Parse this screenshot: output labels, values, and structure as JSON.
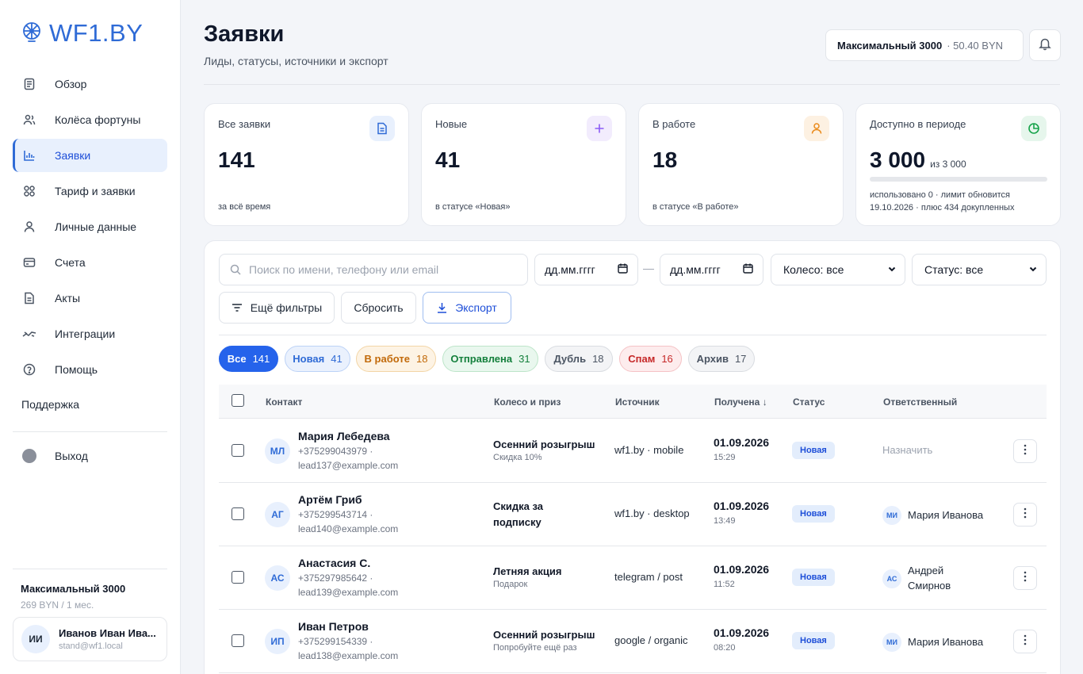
{
  "brand": {
    "logo_text": "WF1.BY",
    "accent": "#2f6bd6"
  },
  "sidebar": {
    "items": [
      {
        "label": "Обзор",
        "icon": "document-list-icon"
      },
      {
        "label": "Колёса фортуны",
        "icon": "users-icon"
      },
      {
        "label": "Заявки",
        "icon": "bar-chart-icon",
        "active": true
      },
      {
        "label": "Тариф и заявки",
        "icon": "grid-icon"
      },
      {
        "label": "Личные данные",
        "icon": "user-icon"
      },
      {
        "label": "Счета",
        "icon": "credit-card-icon"
      },
      {
        "label": "Акты",
        "icon": "file-icon"
      },
      {
        "label": "Интеграции",
        "icon": "link-icon"
      },
      {
        "label": "Помощь",
        "icon": "help-circle-icon"
      }
    ],
    "support": "Поддержка",
    "exit": "Выход",
    "plan_name": "Максимальный 3000",
    "plan_price": "269 BYN / 1 мес.",
    "user": {
      "initials": "ИИ",
      "name": "Иванов Иван Ива...",
      "email": "stand@wf1.local"
    }
  },
  "header": {
    "title": "Заявки",
    "subtitle": "Лиды, статусы, источники и экспорт",
    "plan_label": "Максимальный 3000",
    "plan_balance": "· 50.40 BYN"
  },
  "stats": [
    {
      "label": "Все заявки",
      "value": "141",
      "foot": "за всё время",
      "icon": "document-icon",
      "color": "#2f6bd6"
    },
    {
      "label": "Новые",
      "value": "41",
      "foot": "в статусе «Новая»",
      "icon": "plus-icon",
      "color": "#8b5cf6"
    },
    {
      "label": "В работе",
      "value": "18",
      "foot": "в статусе «В работе»",
      "icon": "user-icon",
      "color": "#ea8a1a"
    },
    {
      "label": "Доступно в периоде",
      "value": "3 000",
      "of": "из 3 000",
      "progress": 0.0,
      "foot_line1": "использовано 0 · лимит обновится",
      "foot_line2": "19.10.2026 · плюс 434 докупленных",
      "icon": "pie-chart-icon",
      "color": "#16a34a"
    }
  ],
  "filters": {
    "search_placeholder": "Поиск по имени, телефону или email",
    "date_from": "дд.мм.гггг",
    "date_to": "дд.мм.гггг",
    "dash": "—",
    "wheel_select": "Колесо: все",
    "status_select": "Статус: все",
    "more_filters": "Ещё фильтры",
    "reset": "Сбросить",
    "export": "Экспорт"
  },
  "chips": [
    {
      "label": "Все",
      "count": "141",
      "bg": "#2563eb",
      "fg": "#ffffff",
      "border": "#2563eb"
    },
    {
      "label": "Новая",
      "count": "41",
      "bg": "#eaf1fd",
      "fg": "#2f6bd6",
      "border": "#bcd2f6"
    },
    {
      "label": "В работе",
      "count": "18",
      "bg": "#fdf3e4",
      "fg": "#c26a0a",
      "border": "#f3d5a6"
    },
    {
      "label": "Отправлена",
      "count": "31",
      "bg": "#e9f7ee",
      "fg": "#15803d",
      "border": "#bde5c9"
    },
    {
      "label": "Дубль",
      "count": "18",
      "bg": "#f3f4f6",
      "fg": "#4b5563",
      "border": "#d9dce1"
    },
    {
      "label": "Спам",
      "count": "16",
      "bg": "#fdeced",
      "fg": "#c62828",
      "border": "#f5c2c5"
    },
    {
      "label": "Архив",
      "count": "17",
      "bg": "#f3f4f6",
      "fg": "#4b5563",
      "border": "#d9dce1"
    }
  ],
  "table": {
    "headers": [
      "Контакт",
      "Колесо и приз",
      "Источник",
      "Получена ↓",
      "Статус",
      "Ответственный"
    ],
    "rows": [
      {
        "initials": "МЛ",
        "name": "Мария Лебедева",
        "phone": "+375299043979 ·",
        "email": "lead137@example.com",
        "wheel": "Осенний розыгрыш",
        "prize": "Скидка 10%",
        "source": "wf1.by · mobile",
        "date": "01.09.2026",
        "time": "15:29",
        "status": "Новая",
        "assign": "Назначить"
      },
      {
        "initials": "АГ",
        "name": "Артём Гриб",
        "phone": "+375299543714 ·",
        "email": "lead140@example.com",
        "wheel": "Скидка за подписку",
        "prize": "",
        "source": "wf1.by · desktop",
        "date": "01.09.2026",
        "time": "13:49",
        "status": "Новая",
        "resp_initials": "МИ",
        "resp_name": "Мария Иванова"
      },
      {
        "initials": "АС",
        "name": "Анастасия С.",
        "phone": "+375297985642 ·",
        "email": "lead139@example.com",
        "wheel": "Летняя акция",
        "prize": "Подарок",
        "source": "telegram / post",
        "date": "01.09.2026",
        "time": "11:52",
        "status": "Новая",
        "resp_initials": "АС",
        "resp_name": "Андрей Смирнов"
      },
      {
        "initials": "ИП",
        "name": "Иван Петров",
        "phone": "+375299154339 ·",
        "email": "lead138@example.com",
        "wheel": "Осенний розыгрыш",
        "prize": "Попробуйте ещё раз",
        "source": "google / organic",
        "date": "01.09.2026",
        "time": "08:20",
        "status": "Новая",
        "resp_initials": "МИ",
        "resp_name": "Мария Иванова"
      }
    ]
  }
}
